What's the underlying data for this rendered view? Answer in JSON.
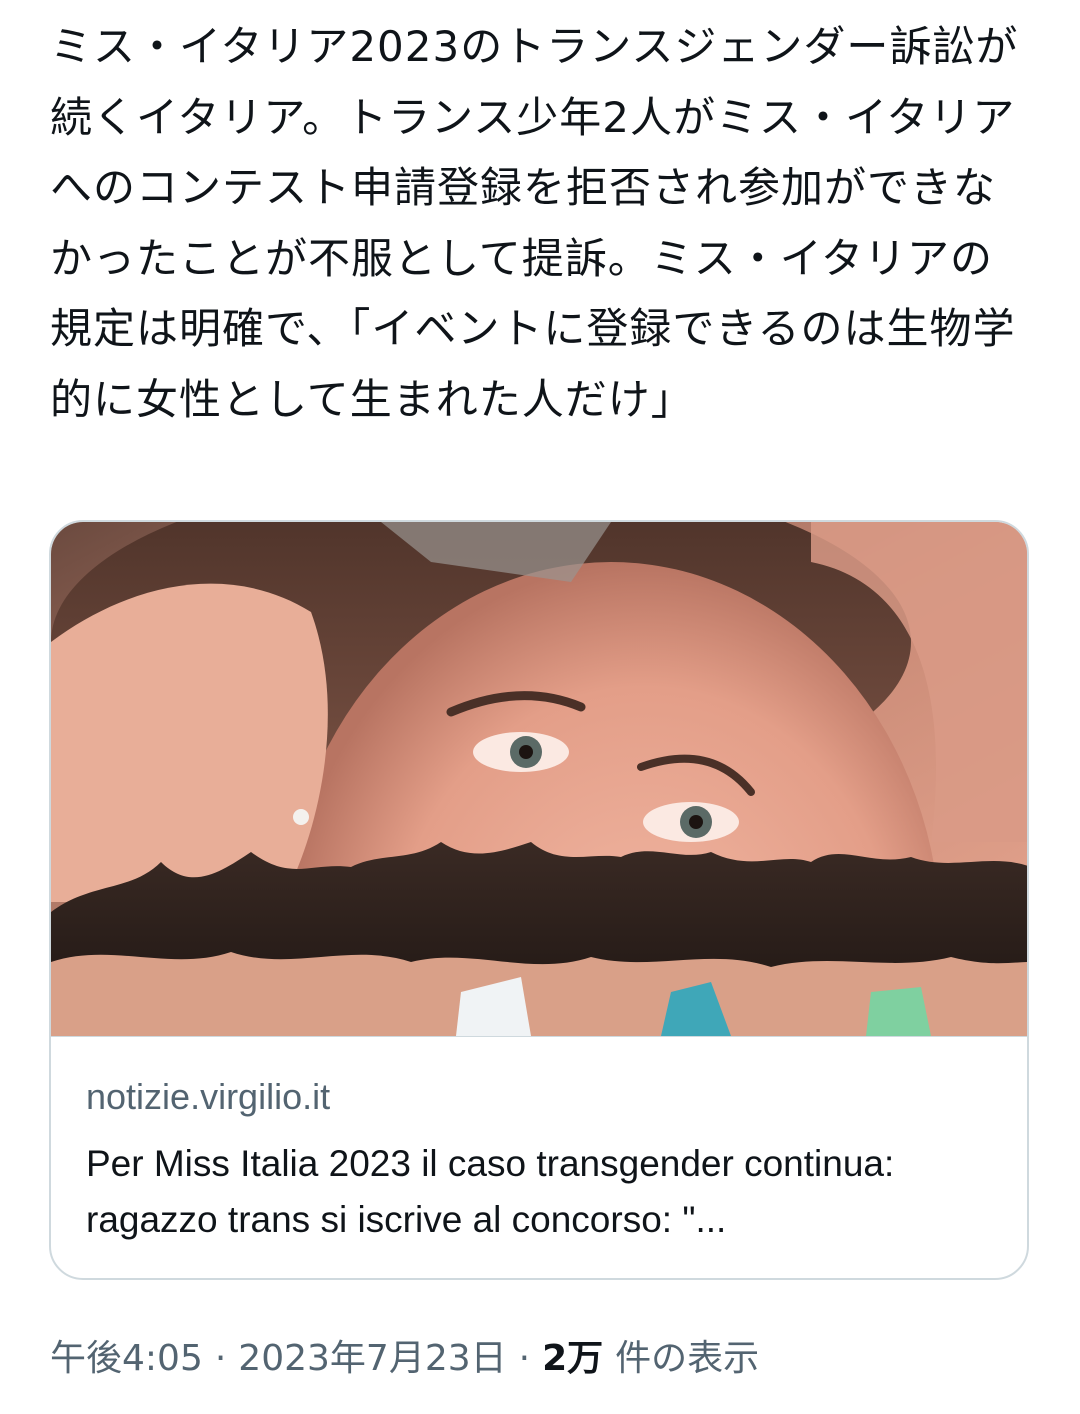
{
  "tweet": {
    "text": "ミス・イタリア2023のトランスジェンダー訴訟が続くイタリア。トランス少年2人がミス・イタリアへのコンテスト申請登録を拒否され参加ができなかったことが不服として提訴。ミス・イタリアの規定は明確で、「イベントに登録できるのは生物学的に女性として生まれた人だけ」"
  },
  "card": {
    "domain": "notizie.virgilio.it",
    "title": "Per Miss Italia 2023 il caso transgender continua: ragazzo trans si iscrive al concorso: \"...",
    "image_alt": "photo-crowd-of-contestants-beneath-giant-portrait"
  },
  "meta": {
    "time": "午後4:05",
    "separator": "·",
    "date": "2023年7月23日",
    "views_count": "2万",
    "views_label": "件の表示"
  },
  "colors": {
    "text": "#0f1419",
    "secondary": "#536471",
    "border": "#cfd9de"
  }
}
